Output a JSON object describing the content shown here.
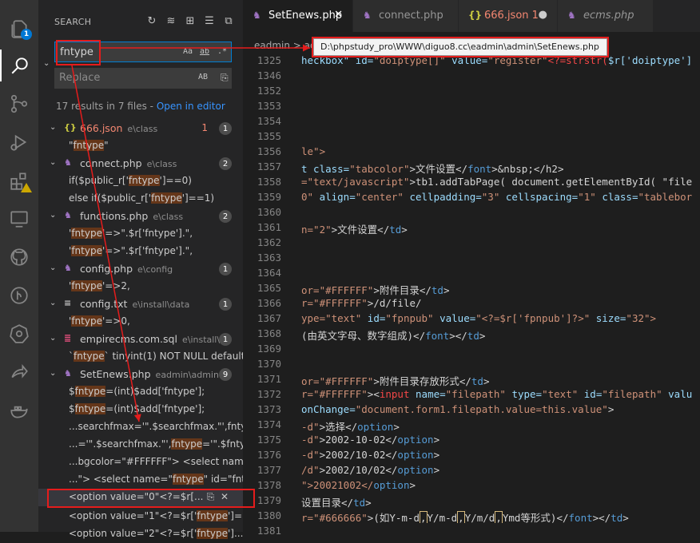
{
  "activity_bar": {
    "explorer_badge": "1"
  },
  "sidebar": {
    "title": "SEARCH",
    "search_value": "fntype",
    "replace_placeholder": "Replace",
    "opt_case": "Aa",
    "opt_word": "ab",
    "opt_regex": ".*",
    "opt_preserve_case": "AB",
    "results_summary": "17 results in 7 files -",
    "open_in_editor": "Open in editor"
  },
  "results": {
    "f666": {
      "name": "666.json",
      "path": "e\\class",
      "errors": "1",
      "count": "1",
      "icon": "{}"
    },
    "f666_m1": "\"fntype\"",
    "connect": {
      "name": "connect.php",
      "path": "e\\class",
      "count": "2"
    },
    "connect_m1": "if($public_r['fntype']==0)",
    "connect_m2": "else if($public_r['fntype']==1)",
    "functions": {
      "name": "functions.php",
      "path": "e\\class",
      "count": "2"
    },
    "functions_m1": "'fntype'=>\".$r['fntype'].\",",
    "functions_m2": "'fntype'=>\".$r['fntype'].\",",
    "config": {
      "name": "config.php",
      "path": "e\\config",
      "count": "1"
    },
    "config_m1": "'fntype'=>2,",
    "configtxt": {
      "name": "config.txt",
      "path": "e\\install\\data",
      "count": "1"
    },
    "configtxt_m1": "'fntype'=>0,",
    "sql": {
      "name": "empirecms.com.sql",
      "path": "e\\install\\...",
      "count": "1"
    },
    "sql_m1": "`fntype` tinyint(1) NOT NULL default...",
    "setenews": {
      "name": "SetEnews.php",
      "path": "eadmin\\admin",
      "count": "9"
    },
    "se_m1": "$fntype=(int)$add['fntype'];",
    "se_m2": "$fntype=(int)$add['fntype'];",
    "se_m3": "...searchfmax='\".$searchfmax.\"',fnty...",
    "se_m4": "...='\".$searchfmax.\"',fntype='\".$fnty...",
    "se_m5": "...bgcolor=\"#FFFFFF\"> <select name...",
    "se_m6": "...\"> <select name=\"fntype\" id=\"fnty...",
    "se_m7": "<option value=\"0\"<?=$r[...",
    "se_m8": "<option value=\"1\"<?=$r['fntype']==...",
    "se_m9": "<option value=\"2\"<?=$r['fntype']..."
  },
  "tabs": [
    {
      "label": "SetEnews.php",
      "icon": "php-icon",
      "color": "#a074c4"
    },
    {
      "label": "connect.php",
      "icon": "php-icon",
      "color": "#a074c4"
    },
    {
      "label": "666.json",
      "badge": "1",
      "icon": "{}",
      "color": "#cbcb41"
    },
    {
      "label": "ecms.php",
      "icon": "php-icon",
      "color": "#a074c4"
    }
  ],
  "breadcrumb": "eadmin > ad",
  "tooltip_path": "D:\\phpstudy_pro\\WWW\\diguo8.cc\\eadmin\\admin\\SetEnews.php",
  "code": {
    "l1325": "1325",
    "c1325a": "heckbox\" ",
    "c1325b": "id=",
    "c1325c": "\"doiptype[]\" ",
    "c1325d": "value=",
    "c1325e": "\"register\"",
    "c1325f": "<?=strstr(",
    "c1325g": "$r['doiptype']",
    "l1346": "1346",
    "l1352": "1352",
    "l1353": "1353",
    "l1354": "1354",
    "l1355": "1355",
    "l1356": "1356",
    "c1356": "le\">",
    "l1357": "1357",
    "c1357a": "t class=",
    "c1357b": "\"tabcolor\"",
    "c1357c": ">文件设置</",
    "c1357d": "font",
    "c1357e": ">&nbsp;</h2>",
    "l1358": "1358",
    "c1358a": "=\"text/javascript\"",
    "c1358b": ">tb1.addTabPage( document.getElementById( \"file",
    "l1359": "1359",
    "c1359a": "0\" ",
    "c1359b": "align=",
    "c1359c": "\"center\" ",
    "c1359d": "cellpadding=",
    "c1359e": "\"3\" ",
    "c1359f": "cellspacing=",
    "c1359g": "\"1\" ",
    "c1359h": "class=",
    "c1359i": "\"tablebor",
    "l1360": "1360",
    "l1361": "1361",
    "c1361a": "n=\"2\"",
    "c1361b": ">文件设置</",
    "c1361c": "td",
    "c1361d": ">",
    "l1362": "1362",
    "l1363": "1363",
    "l1364": "1364",
    "l1365": "1365",
    "c1365a": "or=\"#FFFFFF\"",
    "c1365b": ">附件目录</",
    "c1365c": "td",
    "c1365d": ">",
    "l1366": "1366",
    "c1366a": "r=\"#FFFFFF\"",
    "c1366b": ">/d/file/",
    "l1367": "1367",
    "c1367a": "ype=\"text\" ",
    "c1367b": "id=",
    "c1367c": "\"fpnpub\" ",
    "c1367d": "value=",
    "c1367e": "\"<?=$r['fpnpub']?>\" ",
    "c1367f": "size=",
    "c1367g": "\"32\">",
    "l1368": "1368",
    "c1368a": "(由英文字母、数字组成)</",
    "c1368b": "font",
    "c1368c": "></",
    "c1368d": "td",
    "c1368e": ">",
    "l1369": "1369",
    "l1370": "1370",
    "l1371": "1371",
    "c1371a": "or=\"#FFFFFF\"",
    "c1371b": ">附件目录存放形式</",
    "c1371c": "td",
    "c1371d": ">",
    "l1372": "1372",
    "c1372a": "r=\"#FFFFFF\"",
    "c1372b": "><",
    "c1372c": "input ",
    "c1372d": "name=",
    "c1372e": "\"filepath\" ",
    "c1372f": "type=",
    "c1372g": "\"text\" ",
    "c1372h": "id=",
    "c1372i": "\"filepath\" ",
    "c1372j": "valu",
    "l1373": "1373",
    "c1373a": "onChange=",
    "c1373b": "\"document.form1.filepath.value=this.value\"",
    "c1373c": ">",
    "l1374": "1374",
    "c1374a": "-d\"",
    "c1374b": ">选择</",
    "c1374c": "option",
    "c1374d": ">",
    "l1375": "1375",
    "c1375a": "-d\"",
    "c1375b": ">2002-10-02</",
    "c1375c": "option",
    "c1375d": ">",
    "l1376": "1376",
    "c1376a": "-d\"",
    "c1376b": ">2002/10-02</",
    "c1376c": "option",
    "c1376d": ">",
    "l1377": "1377",
    "c1377a": "/d\"",
    "c1377b": ">2002/10/02</",
    "c1377c": "option",
    "c1377d": ">",
    "l1378": "1378",
    "c1378a": "\">20021002</",
    "c1378b": "option",
    "c1378c": ">",
    "l1379": "1379",
    "c1379a": "设置目录</",
    "c1379b": "td",
    "c1379c": ">",
    "l1380": "1380",
    "c1380a": "r=\"#666666\"",
    "c1380b": ">(如Y-m-d",
    "c1380c": ",",
    "c1380d": "Y/m-d",
    "c1380e": ",",
    "c1380f": "Y/m/d",
    "c1380g": ",",
    "c1380h": "Ymd等形式)</",
    "c1380i": "font",
    "c1380j": "></",
    "c1380k": "td",
    "c1380l": ">",
    "l1381": "1381"
  }
}
